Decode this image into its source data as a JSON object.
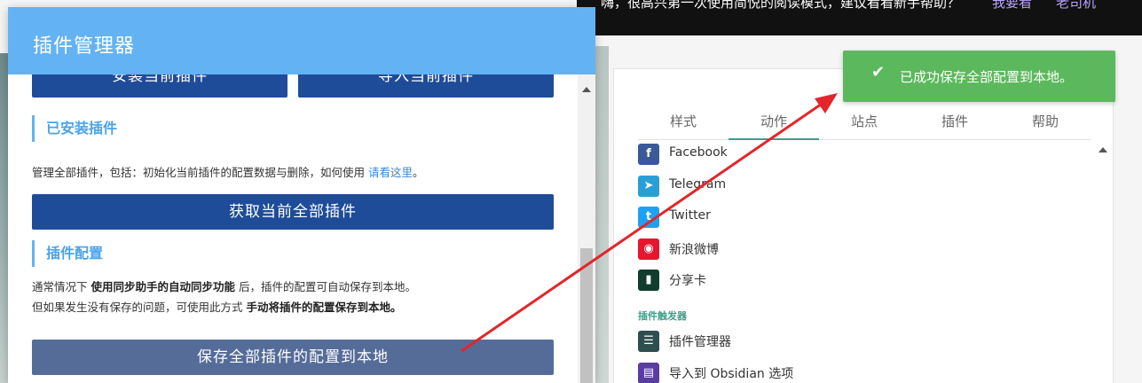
{
  "dialog": {
    "title": "插件管理器",
    "buttons": {
      "install": "安装当前插件",
      "import": "导入当前插件",
      "fetch_all": "获取当前全部插件",
      "save_all": "保存全部插件的配置到本地"
    },
    "installed": {
      "heading": "已安装插件",
      "desc_prefix": "管理全部插件，包括：初始化当前插件的配置数据与删除，如何使用",
      "desc_link": "请看这里",
      "desc_suffix": "。"
    },
    "config": {
      "heading": "插件配置",
      "line1_a": "通常情况下",
      "line1_b": "使用同步助手的自动同步功能",
      "line1_c": "后，插件的配置可自动保存到本地。",
      "line2_a": "但如果发生没有保存的问题，可使用此方式",
      "line2_b": "手动将插件的配置保存到本地。"
    }
  },
  "banner": {
    "text": "嗨，很高兴第一次使用简悦的阅读模式，建议看看新手帮助？",
    "link_help": "我要看",
    "link_veteran": "老司机"
  },
  "toast": {
    "text": "已成功保存全部配置到本地。",
    "icon": "check-icon",
    "color": "#5cb85c"
  },
  "panel": {
    "tabs": [
      "样式",
      "动作",
      "站点",
      "插件",
      "帮助"
    ],
    "active_tab": "动作",
    "items": [
      {
        "label": "Facebook",
        "icon": "facebook-icon",
        "glyph": "f",
        "color": "#3b5998"
      },
      {
        "label": "Telegram",
        "icon": "telegram-icon",
        "glyph": "➤",
        "color": "#2a9fd6"
      },
      {
        "label": "Twitter",
        "icon": "twitter-icon",
        "glyph": "t",
        "color": "#1da1f2"
      },
      {
        "label": "新浪微博",
        "icon": "weibo-icon",
        "glyph": "◉",
        "color": "#e6162d"
      },
      {
        "label": "分享卡",
        "icon": "share-card-icon",
        "glyph": "▮",
        "color": "#0f3d2e"
      }
    ],
    "group_title": "插件触发器",
    "trigger_items": [
      {
        "label": "插件管理器",
        "icon": "list-icon",
        "glyph": "☰",
        "color": "#2f4f4f"
      },
      {
        "label": "导入到 Obsidian 选项",
        "icon": "obsidian-icon",
        "glyph": "▤",
        "color": "#5a3d9e"
      }
    ]
  },
  "colors": {
    "header": "#63b3f4",
    "primary_button": "#1f4c98",
    "muted_button": "#556c99",
    "accent_green": "#3aa08a",
    "arrow": "#e2262a"
  }
}
